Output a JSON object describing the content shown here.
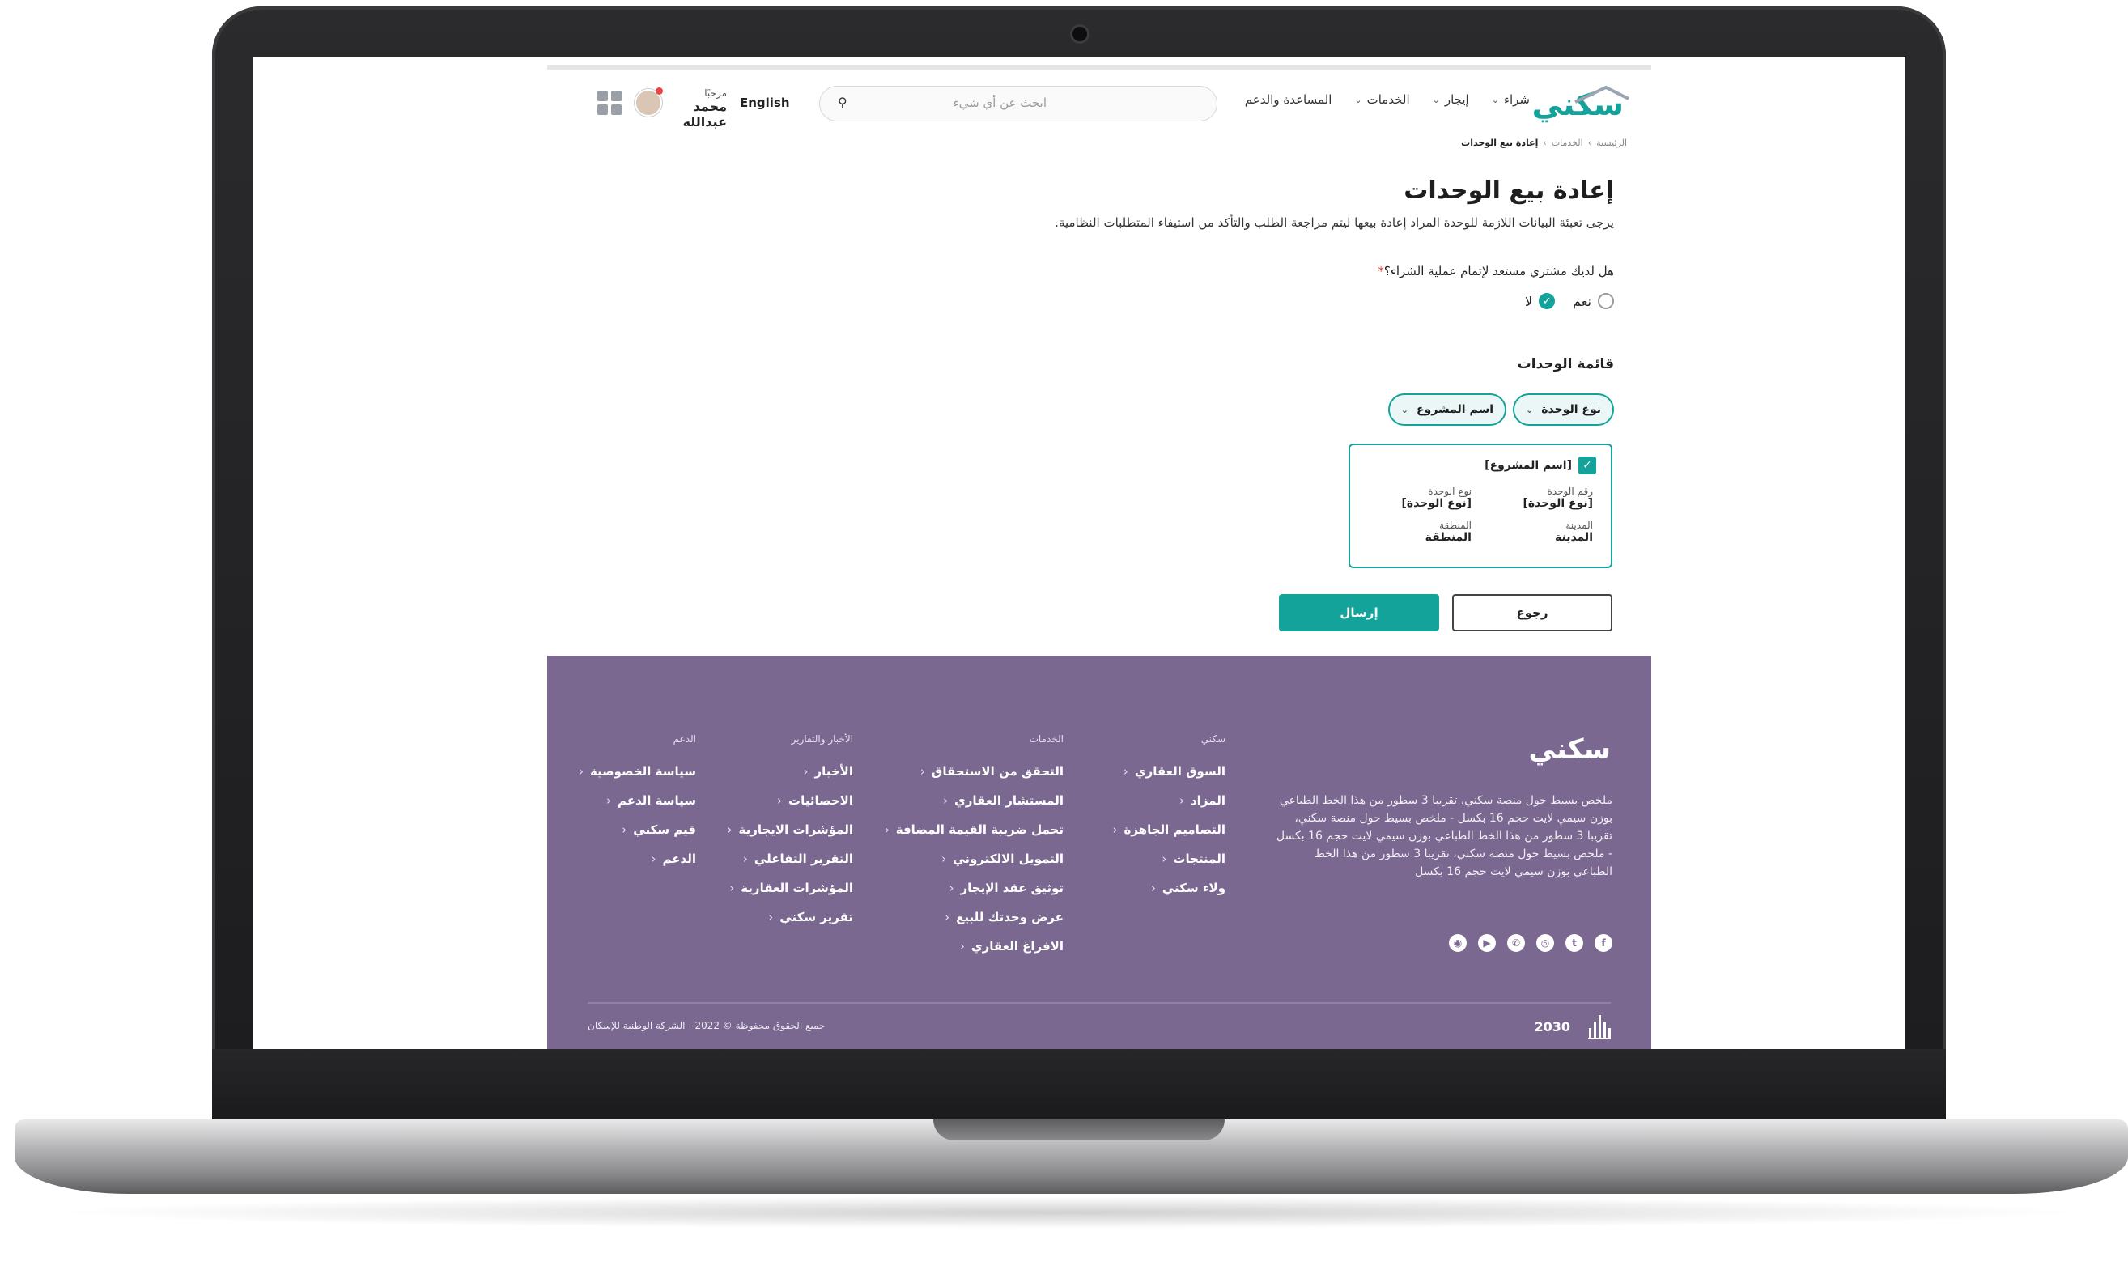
{
  "header": {
    "logo": "سكني",
    "nav": [
      {
        "label": "شراء",
        "has_menu": true
      },
      {
        "label": "إيجار",
        "has_menu": true
      },
      {
        "label": "الخدمات",
        "has_menu": true
      },
      {
        "label": "المساعدة والدعم",
        "has_menu": false
      }
    ],
    "search_placeholder": "ابحث عن أي شيء",
    "language": "English",
    "user_greeting": "مرحبًا",
    "user_name": "محمد عبدالله"
  },
  "breadcrumb": [
    "الرئيسية",
    "الخدمات",
    "إعادة بيع الوحدات"
  ],
  "form": {
    "title": "إعادة بيع الوحدات",
    "description": "يرجى تعبئة البيانات اللازمة للوحدة المراد إعادة بيعها ليتم مراجعة الطلب والتأكد من استيفاء المتطلبات النظامية.",
    "question": "هل لديك مشتري مستعد لإتمام عملية الشراء؟",
    "required_mark": "*",
    "options": [
      {
        "label": "نعم",
        "selected": false
      },
      {
        "label": "لا",
        "selected": true
      }
    ],
    "units_title": "قائمة الوحدات",
    "filters": [
      "نوع الوحدة",
      "اسم المشروع"
    ],
    "unit_card": {
      "project_name": "[اسم المشروع]",
      "fields": [
        {
          "label": "رقم الوحدة",
          "value": "[نوع الوحدة]"
        },
        {
          "label": "نوع الوحدة",
          "value": "[نوع الوحدة]"
        },
        {
          "label": "المدينة",
          "value": "المدينة"
        },
        {
          "label": "المنطقة",
          "value": "المنطقة"
        }
      ]
    },
    "buttons": {
      "back": "رجوع",
      "submit": "إرسال"
    }
  },
  "footer": {
    "logo": "سكني",
    "about": "ملخص بسيط حول منصة سكني، تقريبا 3 سطور من هذا الخط الطباعي بوزن سيمي لايت حجم 16 بكسل - ملخص بسيط حول منصة سكني، تقريبا 3 سطور من هذا الخط الطباعي بوزن سيمي لايت حجم 16 بكسل - ملخص بسيط حول منصة سكني، تقريبا 3 سطور من هذا الخط الطباعي بوزن سيمي لايت حجم 16 بكسل",
    "social": [
      "facebook-icon",
      "twitter-icon",
      "instagram-icon",
      "whatsapp-icon",
      "youtube-icon",
      "snapchat-icon"
    ],
    "columns": [
      {
        "title": "سكني",
        "links": [
          "السوق العقاري",
          "المزاد",
          "التصاميم الجاهزة",
          "المنتجات",
          "ولاء سكني"
        ]
      },
      {
        "title": "الخدمات",
        "links": [
          "التحقق من الاستحقاق",
          "المستشار العقاري",
          "تحمل ضريبة القيمة المضافة",
          "التمويل الالكتروني",
          "توثيق عقد الإيجار",
          "عرض وحدتك للبيع",
          "الافراغ العقاري"
        ]
      },
      {
        "title": "الأخبار والتقارير",
        "links": [
          "الأخبار",
          "الاحصائيات",
          "المؤشرات الايجارية",
          "التقرير التفاعلي",
          "المؤشرات العقارية",
          "تقرير سكني"
        ]
      },
      {
        "title": "الدعم",
        "links": [
          "سياسة الخصوصية",
          "سياسة الدعم",
          "قيم سكني",
          "الدعم"
        ]
      }
    ],
    "copyright": "جميع الحقوق محفوظة © 2022 - الشركة الوطنية للإسكان",
    "vision_badge": "2030"
  }
}
